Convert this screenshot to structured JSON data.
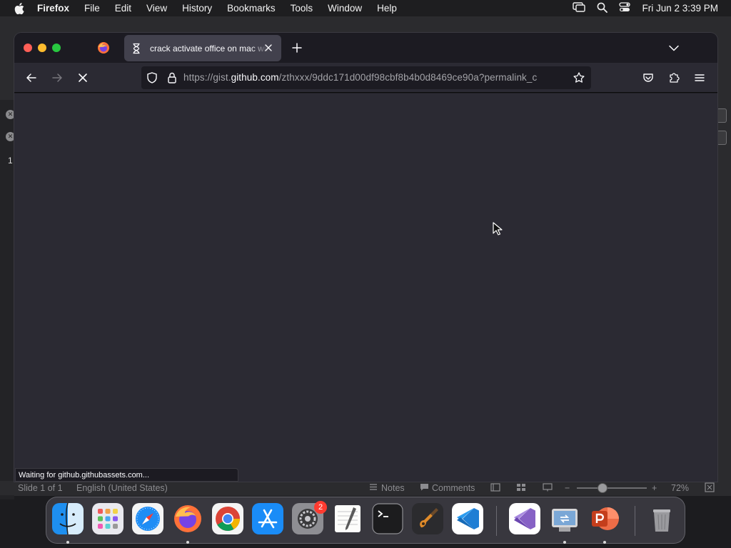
{
  "menubar": {
    "app_name": "Firefox",
    "items": [
      "File",
      "Edit",
      "View",
      "History",
      "Bookmarks",
      "Tools",
      "Window",
      "Help"
    ],
    "clock": "Fri Jun 2  3:39 PM"
  },
  "browser": {
    "tab_title": "crack activate office on mac with",
    "url_prefix": "https://gist.",
    "url_domain": "github.com",
    "url_path": "/zthxxx/9ddc171d00df98cbf8b4b0d8469ce90a?permalink_c",
    "status_text": "Waiting for github.githubassets.com..."
  },
  "powerpoint_status": {
    "slide": "Slide 1 of 1",
    "language": "English (United States)",
    "notes": "Notes",
    "comments": "Comments",
    "zoom": "72%"
  },
  "background_slide_number": "1",
  "dock": {
    "apps": [
      "Finder",
      "Launchpad",
      "Safari",
      "Firefox",
      "Google Chrome",
      "App Store",
      "System Settings",
      "TextEdit",
      "Terminal",
      "GarageBand",
      "Visual Studio Code",
      "Visual Studio",
      "Migration Assistant",
      "Microsoft PowerPoint",
      "Trash"
    ],
    "settings_badge": "2"
  },
  "colors": {
    "accent": "#0a84ff",
    "firefox_toolbar": "#2b2a33",
    "firefox_tabstrip": "#1c1b22",
    "active_tab": "#42414d"
  }
}
